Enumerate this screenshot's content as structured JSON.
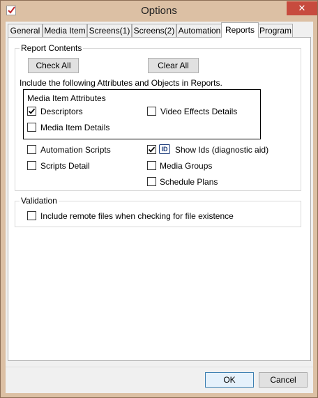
{
  "window": {
    "title": "Options"
  },
  "tabs": [
    {
      "label": "General",
      "active": false
    },
    {
      "label": "Media Item",
      "active": false
    },
    {
      "label": "Screens(1)",
      "active": false
    },
    {
      "label": "Screens(2)",
      "active": false
    },
    {
      "label": "Automation",
      "active": false
    },
    {
      "label": "Reports",
      "active": true
    },
    {
      "label": "Program",
      "active": false
    }
  ],
  "report_contents": {
    "group_label": "Report Contents",
    "check_all_label": "Check All",
    "clear_all_label": "Clear All",
    "instruction": "Include the following Attributes and Objects in Reports.",
    "media_item_attributes": {
      "label": "Media Item Attributes",
      "items": [
        {
          "label": "Descriptors",
          "checked": true
        },
        {
          "label": "Video Effects Details",
          "checked": false
        },
        {
          "label": "Media Item Details",
          "checked": false
        }
      ]
    },
    "objects": [
      {
        "label": "Automation Scripts",
        "checked": false
      },
      {
        "label": "Show Ids (diagnostic aid)",
        "checked": true,
        "icon": "id-badge-icon",
        "icon_text": "ID"
      },
      {
        "label": "Scripts Detail",
        "checked": false
      },
      {
        "label": "Media Groups",
        "checked": false
      },
      {
        "label": "Schedule Plans",
        "checked": false
      }
    ]
  },
  "validation": {
    "group_label": "Validation",
    "items": [
      {
        "label": "Include remote files when checking for file existence",
        "checked": false
      }
    ]
  },
  "footer": {
    "ok_label": "OK",
    "cancel_label": "Cancel"
  },
  "icons": {
    "close": "✕",
    "app": "checkmark-app-icon"
  },
  "colors": {
    "title_bar": "#dcc0a4",
    "close_button": "#c74b3e",
    "accent_border": "#3c7fb1"
  }
}
